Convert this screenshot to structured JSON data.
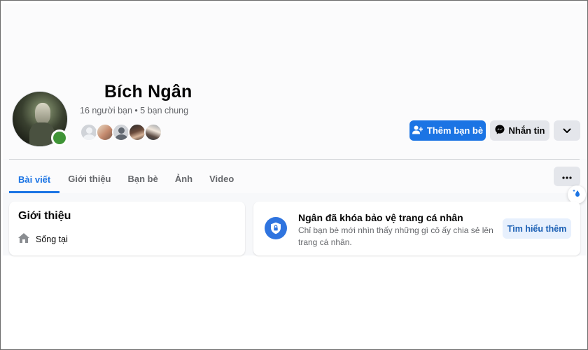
{
  "profile": {
    "name": "Bích Ngân",
    "friends_summary": "16 người bạn • 5 bạn chung",
    "online": true,
    "mutual_friend_avatars": [
      "mutual-friend-1",
      "mutual-friend-2",
      "mutual-friend-3",
      "mutual-friend-4",
      "mutual-friend-5"
    ]
  },
  "actions": {
    "add_friend_label": "Thêm bạn bè",
    "message_label": "Nhắn tin",
    "more_icon": "chevron-down-icon"
  },
  "tabs": [
    {
      "label": "Bài viết",
      "active": true
    },
    {
      "label": "Giới thiệu",
      "active": false
    },
    {
      "label": "Bạn bè",
      "active": false
    },
    {
      "label": "Ảnh",
      "active": false
    },
    {
      "label": "Video",
      "active": false
    }
  ],
  "intro": {
    "title": "Giới thiệu",
    "lives_in_label": "Sống tại",
    "icon": "home-icon"
  },
  "lock_notice": {
    "title": "Ngân đã khóa bảo vệ trang cá nhân",
    "description": "Chỉ bạn bè mới nhìn thấy những gì cô ấy chia sẻ lên trang cá nhân.",
    "learn_more_label": "Tìm hiểu thêm",
    "icon": "shield-lock-icon"
  },
  "colors": {
    "accent": "#1b74e4",
    "online": "#3f9436",
    "secondary_button": "#e4e6eb"
  }
}
